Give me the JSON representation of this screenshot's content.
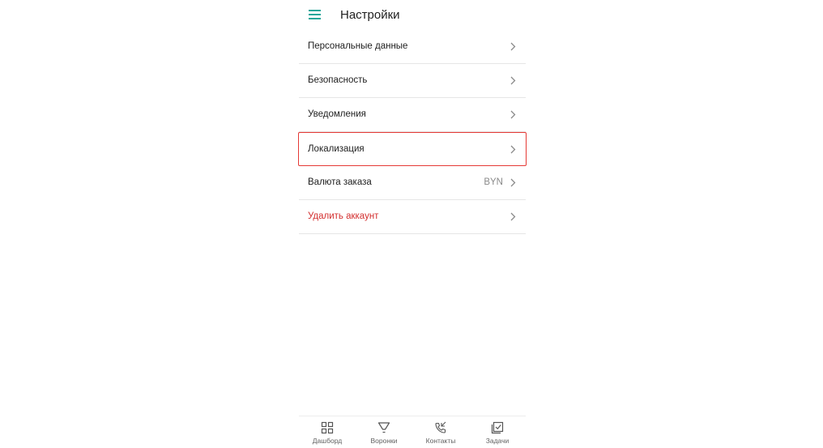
{
  "header": {
    "title": "Настройки",
    "menu_icon": "hamburger-menu-icon",
    "accent_color": "#26a69a"
  },
  "settings": {
    "items": [
      {
        "label": "Персональные данные",
        "value": ""
      },
      {
        "label": "Безопасность",
        "value": ""
      },
      {
        "label": "Уведомления",
        "value": ""
      },
      {
        "label": "Локализация",
        "value": "",
        "highlighted": true
      },
      {
        "label": "Валюта заказа",
        "value": "BYN"
      },
      {
        "label": "Удалить аккаунт",
        "value": "",
        "danger_color": "#d32f2f"
      }
    ]
  },
  "bottom_nav": {
    "items": [
      {
        "label": "Дашборд",
        "icon": "dashboard-grid-icon"
      },
      {
        "label": "Воронки",
        "icon": "funnel-icon"
      },
      {
        "label": "Контакты",
        "icon": "phone-contacts-icon"
      },
      {
        "label": "Задачи",
        "icon": "tasks-checklist-icon"
      }
    ]
  },
  "colors": {
    "highlight_border": "#e53935",
    "divider": "#e6e6e6"
  }
}
